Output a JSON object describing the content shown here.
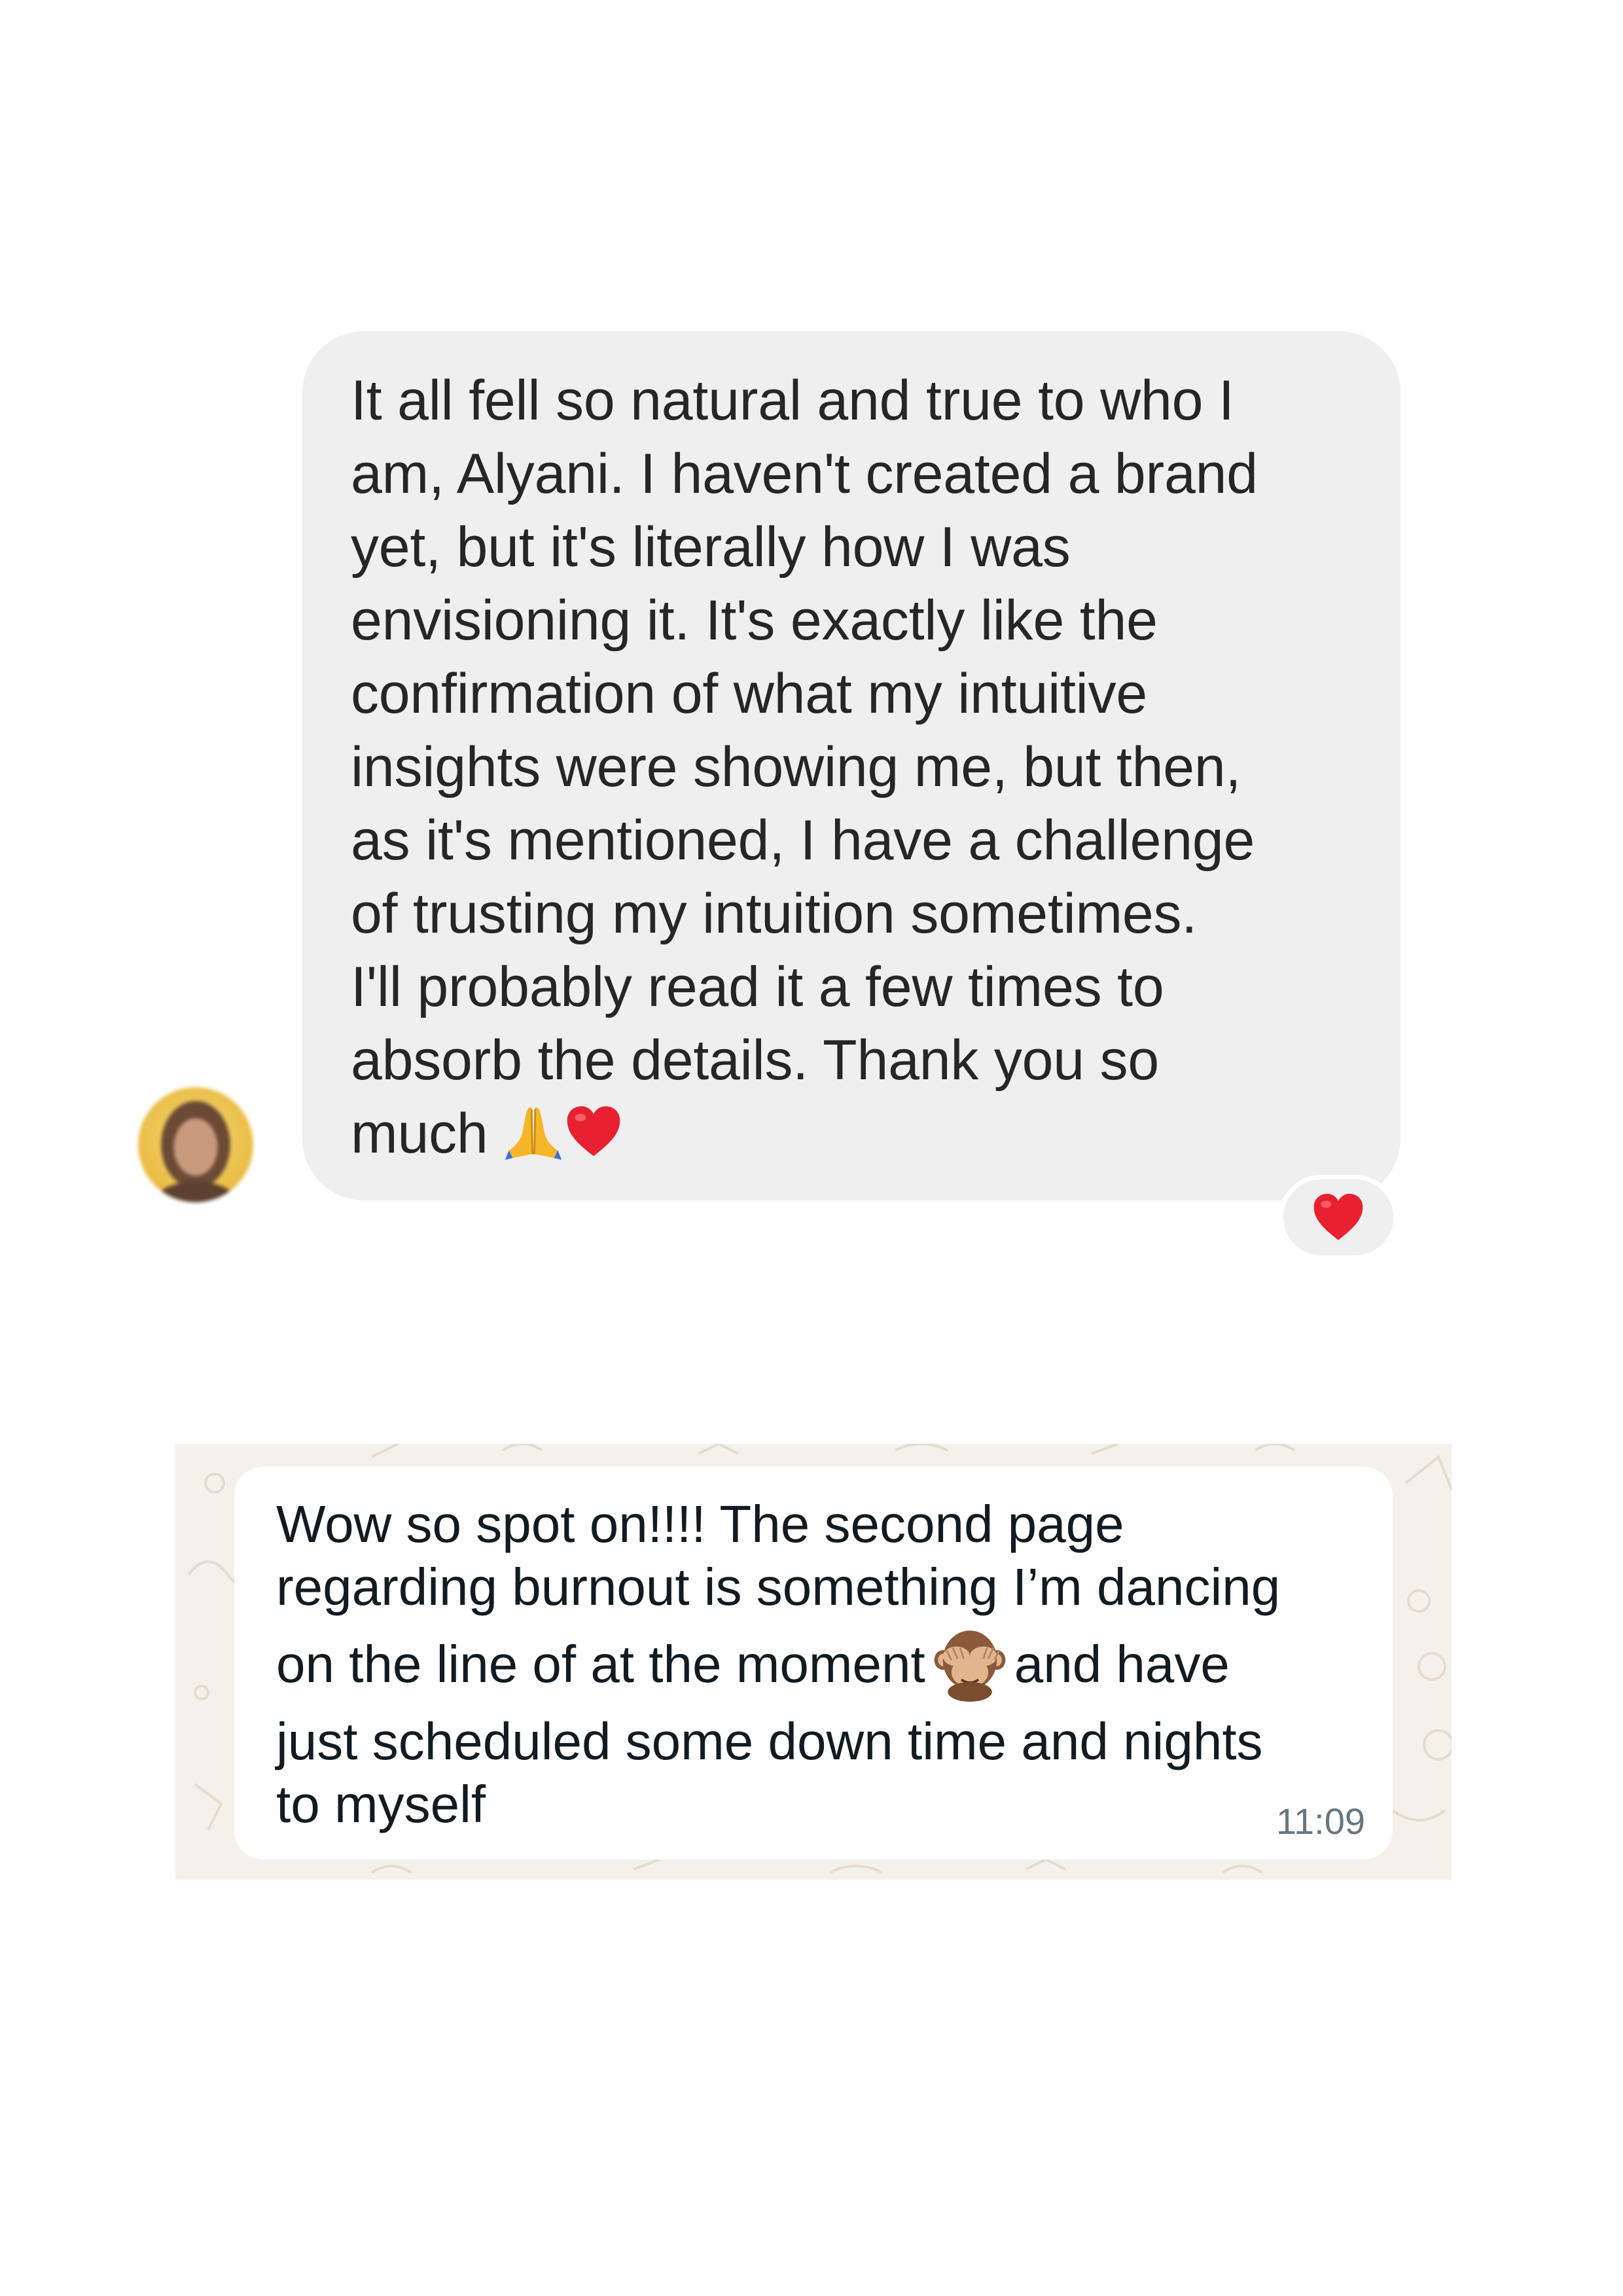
{
  "instagram_message": {
    "avatar": "avatar-photo-blurred",
    "lines": [
      "It all fell so natural and true to who I",
      "am, Alyani. I haven't  created a brand",
      "yet, but it's literally how I was",
      "envisioning it. It's exactly like the",
      "confirmation of what my intuitive",
      "insights were showing me, but then,",
      "as it's mentioned, I have a challenge",
      "of trusting my intuition sometimes.",
      "I'll probably read it a few times to",
      "absorb the details. Thank you so",
      "much"
    ],
    "trailing_emojis": [
      "folded-hands-emoji",
      "red-heart-emoji"
    ],
    "reaction": "red-heart-emoji",
    "bubble_color": "#efefef",
    "text_color": "#262626"
  },
  "whatsapp_message": {
    "line_1": "Wow so spot on!!!! The second page",
    "line_2": "regarding burnout is something I’m dancing",
    "line_3_before_emoji": "on the line of at the moment",
    "inline_emoji": "see-no-evil-monkey-emoji",
    "line_3_after_emoji": "and have",
    "line_4": "just scheduled some down time and nights",
    "line_5": "to myself",
    "timestamp": "11:09",
    "wallpaper_color": "#f4f1ea",
    "bubble_color": "#ffffff",
    "timestamp_color": "#667781"
  }
}
